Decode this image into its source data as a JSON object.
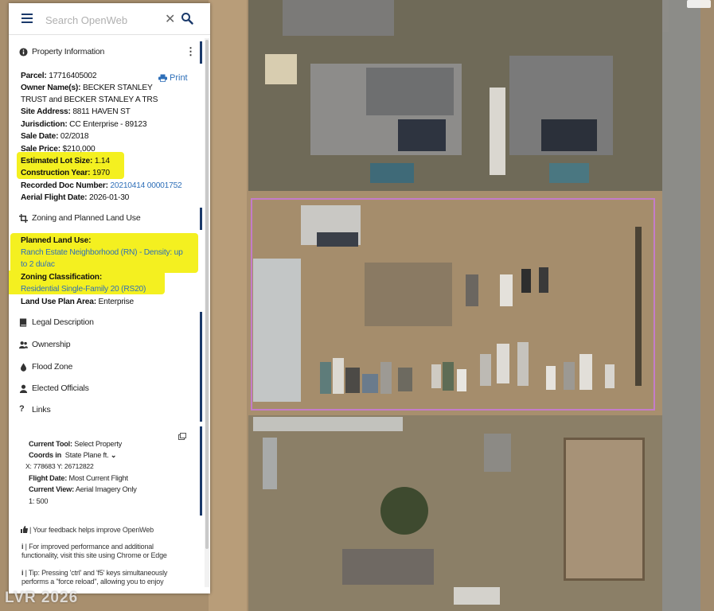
{
  "search": {
    "placeholder": "Search OpenWeb"
  },
  "property_info": {
    "title": "Property Information",
    "print_label": "Print",
    "parcel_label": "Parcel:",
    "parcel_value": "17716405002",
    "owner_label": "Owner Name(s):",
    "owner_value_1": "BECKER STANLEY",
    "owner_value_2": "TRUST and BECKER STANLEY A TRS",
    "site_label": "Site Address:",
    "site_value": "8811 HAVEN ST",
    "jurisdiction_label": "Jurisdiction:",
    "jurisdiction_value": "CC Enterprise - 89123",
    "sale_date_label": "Sale Date:",
    "sale_date_value": "02/2018",
    "sale_price_label": "Sale Price:",
    "sale_price_value": "$210,000",
    "lot_size_label": "Estimated Lot Size:",
    "lot_size_value": "1.14",
    "construction_label": "Construction Year:",
    "construction_value": "1970",
    "recorded_label": "Recorded Doc Number:",
    "recorded_value": "20210414 00001752",
    "flight_label": "Aerial Flight Date:",
    "flight_value": "2026-01-30"
  },
  "zoning": {
    "title": "Zoning and Planned Land Use",
    "planned_label": "Planned Land Use:",
    "planned_value_1": "Ranch Estate Neighborhood (RN) - Density: up",
    "planned_value_2": "to 2 du/ac",
    "classification_label": "Zoning Classification:",
    "classification_value": "Residential Single-Family 20 (RS20)",
    "plan_area_label": "Land Use Plan Area:",
    "plan_area_value": "Enterprise"
  },
  "sections": [
    {
      "label": "Legal Description"
    },
    {
      "label": "Ownership"
    },
    {
      "label": "Flood Zone"
    },
    {
      "label": "Elected Officials"
    },
    {
      "label": "Links"
    }
  ],
  "tool": {
    "current_tool_label": "Current Tool:",
    "current_tool_value": "Select Property",
    "coords_label": "Coords in",
    "coords_value": "State Plane ft.",
    "x_label": "X:",
    "x_value": "778683",
    "y_label": "Y:",
    "y_value": "26712822",
    "flight_label": "Flight Date:",
    "flight_value": "Most Current Flight",
    "view_label": "Current View:",
    "view_value": "Aerial Imagery Only",
    "scale": "1: 500"
  },
  "footer": {
    "feedback": "| Your feedback helps improve OpenWeb",
    "perf_1": "| For improved performance and additional",
    "perf_2": "functionality, visit this site using Chrome or Edge",
    "tip_1": "| Tip: Pressing 'ctrl' and 'f5' keys simultaneously",
    "tip_2": "performs a \"force reload\", allowing you to enjoy"
  },
  "watermark": "LVR 2026",
  "colors": {
    "accent": "#1b3a6b",
    "link": "#2e6fb8",
    "highlight": "#f4f020",
    "parcel_outline": "#c47cc9"
  },
  "icons": {
    "menu": "menu-icon",
    "clear": "close-icon",
    "search": "search-icon",
    "info": "info-icon",
    "print": "printer-icon",
    "zoning": "crop-icon",
    "legal": "book-icon",
    "ownership": "people-icon",
    "flood": "droplet-icon",
    "officials": "person-icon",
    "links": "question-icon",
    "popout": "popout-icon",
    "feedback": "thumbs-up-icon"
  }
}
